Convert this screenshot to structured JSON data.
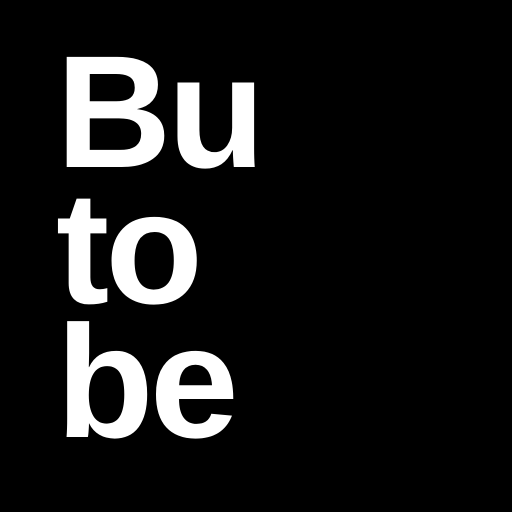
{
  "logo": {
    "lines": [
      "Bu",
      "to",
      "be"
    ],
    "text_color": "#ffffff",
    "background_color": "#000000"
  }
}
